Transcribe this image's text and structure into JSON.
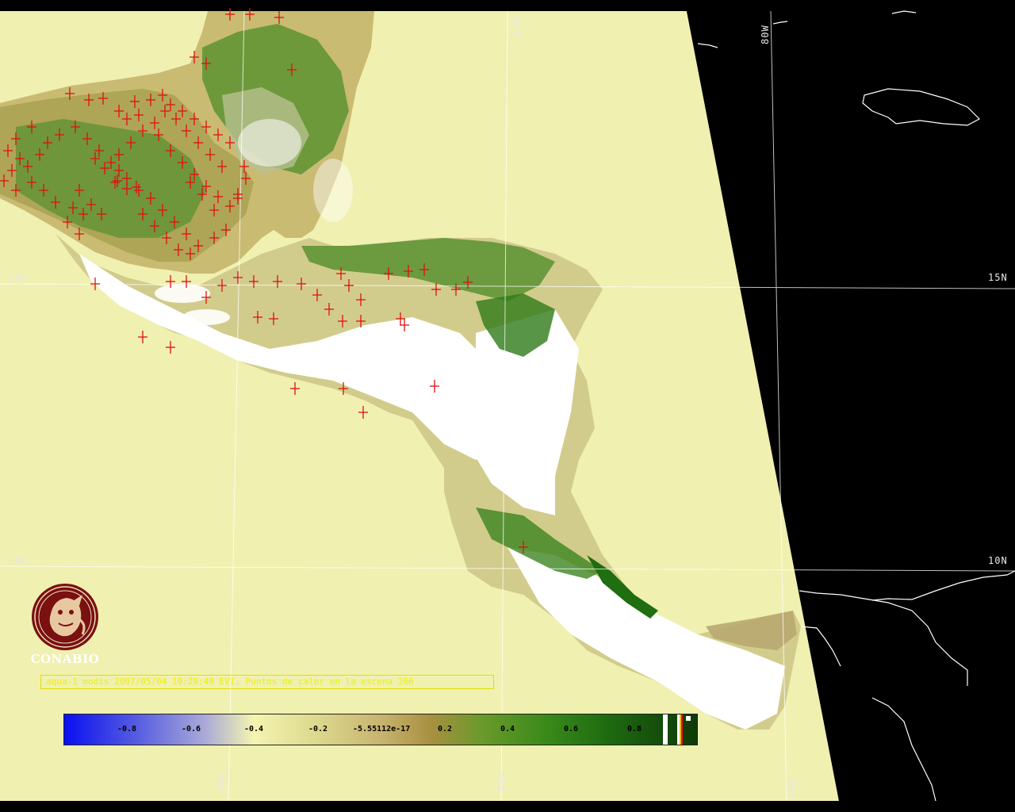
{
  "map": {
    "grid_labels": {
      "lon_85w_top": "85W",
      "lon_80w_top": "80W",
      "lon_90w_bottom": "90W",
      "lon_85w_bottom": "85W",
      "lon_80w_bottom": "80W",
      "lat_15n_left": "15N",
      "lat_15n_right": "15N",
      "lat_10n_left": "10N",
      "lat_10n_right": "10N"
    },
    "colors": {
      "water": "#f0f0b0",
      "outside": "#000000",
      "grid": "#ffffff",
      "coast": "#ffffff",
      "hotspot": "#e01010",
      "land_light": "#d8d29a",
      "land_brown": "#b8a058",
      "land_green": "#2e7e18",
      "cloud": "#ffffff"
    },
    "icons": {
      "hotspot": "red-plus-marker"
    }
  },
  "logo": {
    "name": "CONABIO"
  },
  "caption": {
    "text": "aqua-1 modis 2007/05/04 19:29:49 EVI. Puntos de calor en la escena 266"
  },
  "colorbar": {
    "ticks": [
      "-0.8",
      "-0.6",
      "-0.4",
      "-0.2",
      "-5.55112e-17",
      "0.2",
      "0.4",
      "0.6",
      "0.8"
    ],
    "range": [
      -1.0,
      1.0
    ]
  }
}
